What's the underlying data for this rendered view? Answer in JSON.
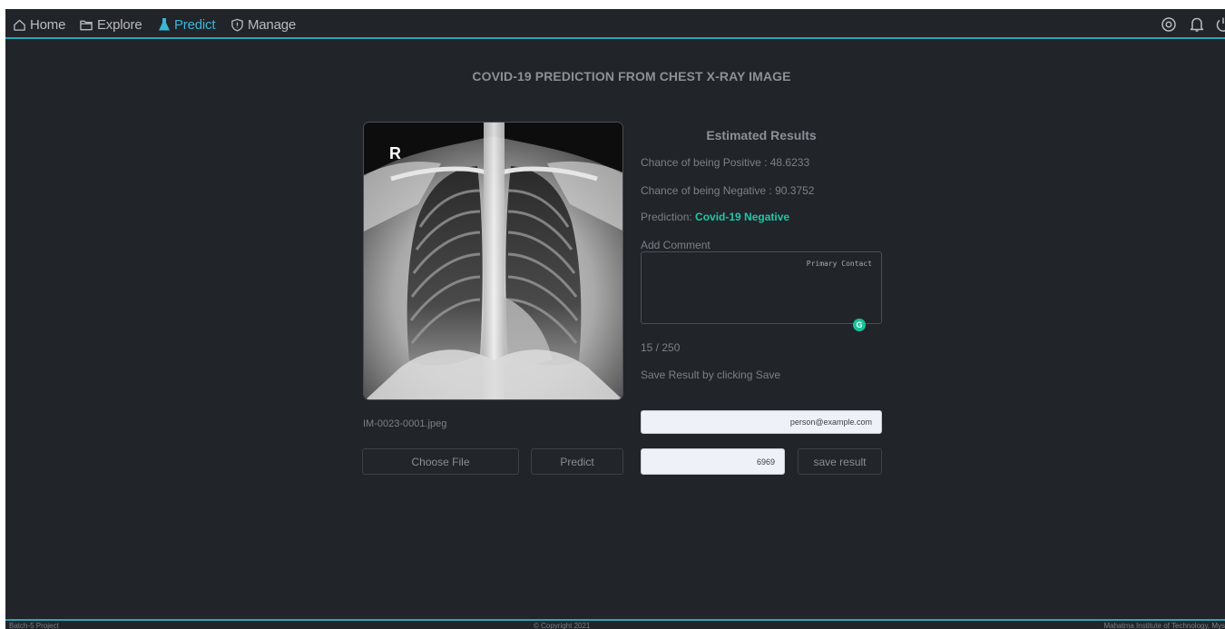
{
  "nav": {
    "items": [
      {
        "label": "Home",
        "icon": "home-icon",
        "active": false
      },
      {
        "label": "Explore",
        "icon": "folder-icon",
        "active": false
      },
      {
        "label": "Predict",
        "icon": "flask-icon",
        "active": true
      },
      {
        "label": "Manage",
        "icon": "shield-icon",
        "active": false
      }
    ],
    "right_icons": [
      "settings-icon",
      "bell-icon",
      "power-icon"
    ],
    "accent_color": "#3ab6d6"
  },
  "page": {
    "title": "COVID-19 PREDICTION FROM CHEST X-RAY IMAGE"
  },
  "xray": {
    "marker": "R",
    "file_name": "IM-0023-0001.jpeg"
  },
  "buttons": {
    "choose_file": "Choose File",
    "predict": "Predict",
    "save_result": "save result"
  },
  "results": {
    "title": "Estimated Results",
    "positive_line": "Chance of being Positive : 48.6233",
    "negative_line": "Chance of being Negative : 90.3752",
    "prediction_label": "Prediction:",
    "prediction_value": "Covid-19 Negative",
    "prediction_color": "#1fc7a8"
  },
  "comment": {
    "label": "Add Comment",
    "value": "Primary Contact",
    "char_count": "15 / 250",
    "grammar_icon_letter": "G"
  },
  "save": {
    "hint": "Save Result by clicking Save",
    "email_value": "person@example.com",
    "id_value": "6969"
  },
  "footer": {
    "left": "Batch-5 Project",
    "center": "© Copyright 2021",
    "right": "Mahatma Institute of Technology, Mys"
  }
}
